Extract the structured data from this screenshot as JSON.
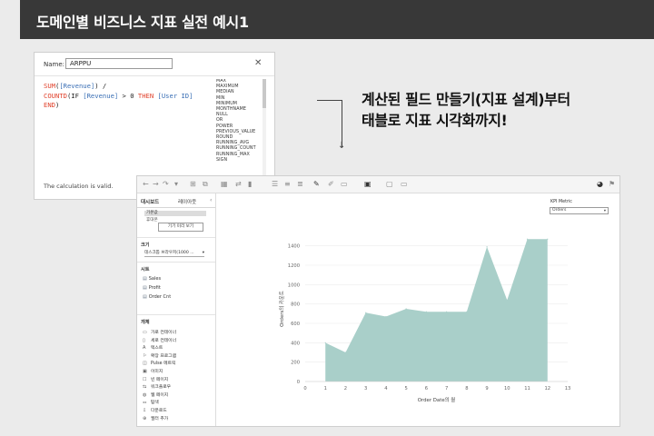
{
  "header": {
    "title": "도메인별 비즈니스 지표 실전 예시1"
  },
  "calc": {
    "name_label": "Name:",
    "name_value": "ARPPU",
    "close": "✕",
    "code": {
      "l1_fn": "SUM",
      "l1_field": "[Revenue]",
      "l1_rest": ") /",
      "l2_fn": "COUNTD",
      "l2_if": "(IF ",
      "l2_field1": "[Revenue]",
      "l2_op": " > 0 ",
      "l2_then": "THEN",
      "l2_field2": "[User ID]",
      "l3_end": "END",
      "l3_close": ")"
    },
    "functions": [
      "MAX",
      "MAXIMUM",
      "MEDIAN",
      "MIN",
      "MINIMUM",
      "MONTHNAME",
      "NULL",
      "OR",
      "POWER",
      "PREVIOUS_VALUE",
      "ROUND",
      "RUNNING_AVG",
      "RUNNING_COUNT",
      "RUNNING_MAX",
      "SIGN"
    ],
    "status": "The calculation is valid."
  },
  "headline": {
    "line1": "계산된 필드 만들기(지표 설계)부터",
    "line2": "태블로 지표 시각화까지!"
  },
  "tableau": {
    "side_tabs": [
      "대시보드",
      "레이아웃"
    ],
    "selected_device": "기본값",
    "sub_device": "휴대폰",
    "preview_button": "기기 미리 보기",
    "size_title": "크기",
    "size_value": "데스크톱 브라우저(1000 ...",
    "sheets_title": "시트",
    "sheets": [
      "Sales",
      "Profit",
      "Order Cnt"
    ],
    "objects_title": "개체",
    "objects": [
      {
        "icon": "▭",
        "label": "가로 컨테이너"
      },
      {
        "icon": "▯",
        "label": "세로 컨테이너"
      },
      {
        "icon": "A",
        "label": "텍스트"
      },
      {
        "icon": "⚐",
        "label": "확장 프로그램"
      },
      {
        "icon": "◫",
        "label": "Pulse 메트릭"
      },
      {
        "icon": "▣",
        "label": "이미지"
      },
      {
        "icon": "☐",
        "label": "빈 페이지"
      },
      {
        "icon": "⇆",
        "label": "워크플로우"
      },
      {
        "icon": "◍",
        "label": "웹 페이지"
      },
      {
        "icon": "⚏",
        "label": "탐색"
      },
      {
        "icon": "⇩",
        "label": "다운로드"
      },
      {
        "icon": "⊕",
        "label": "필터 추가"
      }
    ],
    "kpi_label": "KPI Metric",
    "kpi_value": "Orders"
  },
  "chart_data": {
    "type": "area",
    "xlabel": "Order Date의 월",
    "ylabel": "Orders의 카운트",
    "x": [
      1,
      2,
      3,
      4,
      5,
      6,
      7,
      8,
      9,
      10,
      11,
      12
    ],
    "series": [
      {
        "values": [
          400,
          300,
          710,
          670,
          750,
          720,
          720,
          720,
          1390,
          840,
          1470,
          1470
        ]
      }
    ],
    "xlim": [
      0,
      13
    ],
    "ylim": [
      0,
      1500
    ],
    "yticks": [
      0,
      200,
      400,
      600,
      800,
      1000,
      1200,
      1400
    ],
    "xticks": [
      0,
      1,
      2,
      3,
      4,
      5,
      6,
      7,
      8,
      9,
      10,
      11,
      12,
      13
    ],
    "color": "#a9cfc9",
    "grid": true
  }
}
